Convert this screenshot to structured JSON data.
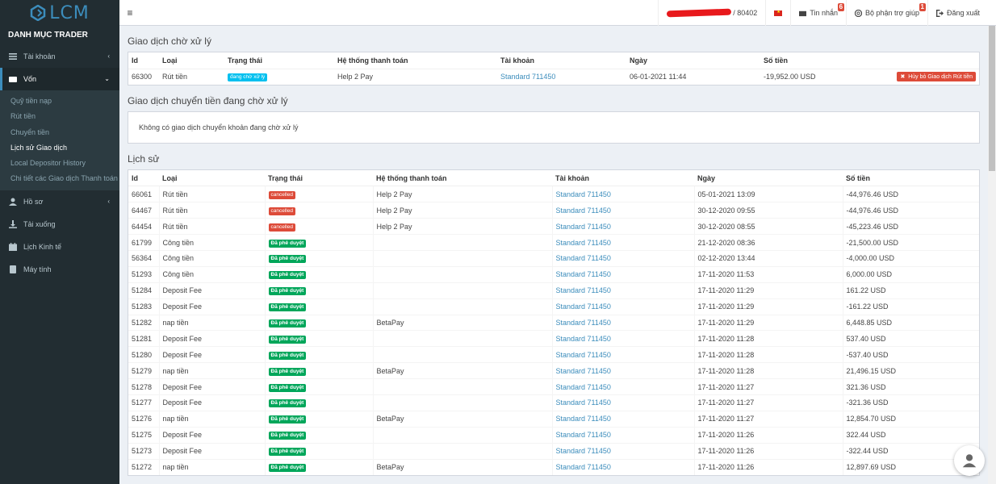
{
  "brand": {
    "logo_text": "LCM"
  },
  "sidebar": {
    "header": "DANH MỤC TRADER",
    "items": [
      {
        "label": "Tài khoản",
        "icon": "list-icon",
        "caret": "‹"
      },
      {
        "label": "Vốn",
        "icon": "money-icon",
        "caret": "⌄"
      },
      {
        "label": "Hồ sơ",
        "icon": "user-icon",
        "caret": "‹"
      },
      {
        "label": "Tải xuống",
        "icon": "download-icon"
      },
      {
        "label": "Lịch Kinh tế",
        "icon": "calendar-icon"
      },
      {
        "label": "Máy tính",
        "icon": "calculator-icon"
      }
    ],
    "submenu": [
      "Quỹ tiền nạp",
      "Rút tiền",
      "Chuyển tiền",
      "Lịch sử Giao dịch",
      "Local Depositor History",
      "Chi tiết các Giao dịch Thanh toán"
    ]
  },
  "topbar": {
    "account_suffix": "/ 80402",
    "messages_label": "Tin nhắn",
    "messages_count": "6",
    "support_label": "Bộ phận trợ giúp",
    "support_count": "1",
    "logout_label": "Đăng xuất"
  },
  "pending": {
    "title": "Giao dịch chờ xử lý",
    "headers": [
      "Id",
      "Loại",
      "Trạng thái",
      "Hệ thống thanh toán",
      "Tài khoản",
      "Ngày",
      "Số tiền"
    ],
    "row": {
      "id": "66300",
      "type": "Rút tiền",
      "status": "đang chờ xử lý",
      "system": "Help 2 Pay",
      "account": "Standard 711450",
      "date": "06-01-2021 11:44",
      "amount": "-19,952.00 USD",
      "action": "Hủy bỏ Giao dịch Rút tiền"
    }
  },
  "transfers": {
    "title": "Giao dịch chuyển tiền đang chờ xử lý",
    "empty": "Không có giao dịch chuyển khoản đang chờ xử lý"
  },
  "history": {
    "title": "Lịch sử",
    "headers": [
      "Id",
      "Loại",
      "Trạng thái",
      "Hệ thống thanh toán",
      "Tài khoản",
      "Ngày",
      "Số tiền"
    ],
    "rows": [
      [
        "66061",
        "Rút tiền",
        "cancelled",
        "Help 2 Pay",
        "Standard 711450",
        "05-01-2021 13:09",
        "-44,976.46 USD"
      ],
      [
        "64467",
        "Rút tiền",
        "cancelled",
        "Help 2 Pay",
        "Standard 711450",
        "30-12-2020 09:55",
        "-44,976.46 USD"
      ],
      [
        "64454",
        "Rút tiền",
        "cancelled",
        "Help 2 Pay",
        "Standard 711450",
        "30-12-2020 08:55",
        "-45,223.46 USD"
      ],
      [
        "61799",
        "Công tiền",
        "Đã phê duyệt",
        "",
        "Standard 711450",
        "21-12-2020 08:36",
        "-21,500.00 USD"
      ],
      [
        "56364",
        "Công tiền",
        "Đã phê duyệt",
        "",
        "Standard 711450",
        "02-12-2020 13:44",
        "-4,000.00 USD"
      ],
      [
        "51293",
        "Công tiền",
        "Đã phê duyệt",
        "",
        "Standard 711450",
        "17-11-2020 11:53",
        "6,000.00 USD"
      ],
      [
        "51284",
        "Deposit Fee",
        "Đã phê duyệt",
        "",
        "Standard 711450",
        "17-11-2020 11:29",
        "161.22 USD"
      ],
      [
        "51283",
        "Deposit Fee",
        "Đã phê duyệt",
        "",
        "Standard 711450",
        "17-11-2020 11:29",
        "-161.22 USD"
      ],
      [
        "51282",
        "nap tiền",
        "Đã phê duyệt",
        "BetaPay",
        "Standard 711450",
        "17-11-2020 11:29",
        "6,448.85 USD"
      ],
      [
        "51281",
        "Deposit Fee",
        "Đã phê duyệt",
        "",
        "Standard 711450",
        "17-11-2020 11:28",
        "537.40 USD"
      ],
      [
        "51280",
        "Deposit Fee",
        "Đã phê duyệt",
        "",
        "Standard 711450",
        "17-11-2020 11:28",
        "-537.40 USD"
      ],
      [
        "51279",
        "nap tiền",
        "Đã phê duyệt",
        "BetaPay",
        "Standard 711450",
        "17-11-2020 11:28",
        "21,496.15 USD"
      ],
      [
        "51278",
        "Deposit Fee",
        "Đã phê duyệt",
        "",
        "Standard 711450",
        "17-11-2020 11:27",
        "321.36 USD"
      ],
      [
        "51277",
        "Deposit Fee",
        "Đã phê duyệt",
        "",
        "Standard 711450",
        "17-11-2020 11:27",
        "-321.36 USD"
      ],
      [
        "51276",
        "nap tiền",
        "Đã phê duyệt",
        "BetaPay",
        "Standard 711450",
        "17-11-2020 11:27",
        "12,854.70 USD"
      ],
      [
        "51275",
        "Deposit Fee",
        "Đã phê duyệt",
        "",
        "Standard 711450",
        "17-11-2020 11:26",
        "322.44 USD"
      ],
      [
        "51273",
        "Deposit Fee",
        "Đã phê duyệt",
        "",
        "Standard 711450",
        "17-11-2020 11:26",
        "-322.44 USD"
      ],
      [
        "51272",
        "nap tiền",
        "Đã phê duyệt",
        "BetaPay",
        "Standard 711450",
        "17-11-2020 11:26",
        "12,897.69 USD"
      ]
    ]
  },
  "colors": {
    "sidebar": "#222d32",
    "accent": "#3c8dbc",
    "danger": "#dd4b39",
    "success": "#00a65a",
    "info": "#00c0ef"
  }
}
